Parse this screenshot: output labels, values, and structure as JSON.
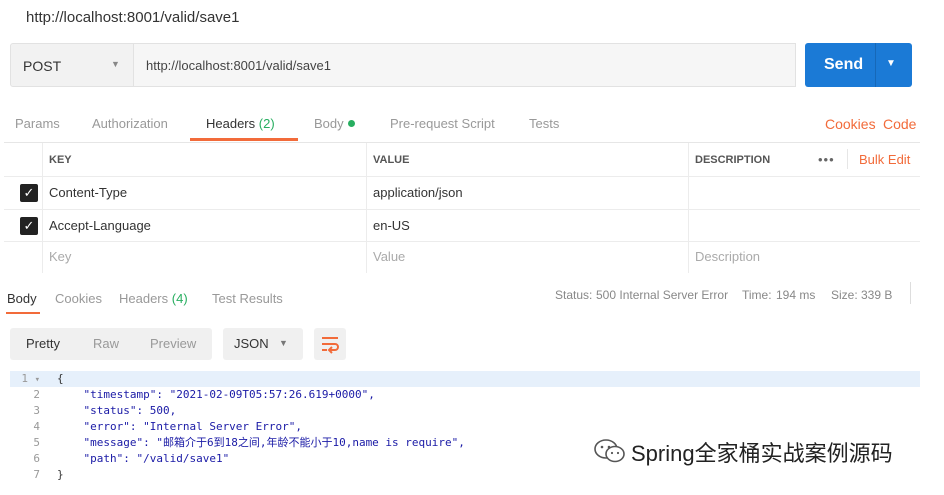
{
  "title": "http://localhost:8001/valid/save1",
  "request": {
    "method": "POST",
    "url": "http://localhost:8001/valid/save1",
    "send_label": "Send"
  },
  "req_tabs": {
    "params": "Params",
    "authorization": "Authorization",
    "headers": "Headers",
    "headers_count": "(2)",
    "body": "Body",
    "pre_request": "Pre-request Script",
    "tests": "Tests",
    "cookies": "Cookies",
    "code": "Code"
  },
  "headers_table": {
    "columns": [
      "KEY",
      "VALUE",
      "DESCRIPTION"
    ],
    "bulk_edit": "Bulk Edit",
    "more": "•••",
    "rows": [
      {
        "key": "Content-Type",
        "value": "application/json",
        "checked": true
      },
      {
        "key": "Accept-Language",
        "value": "en-US",
        "checked": true
      }
    ],
    "placeholder": {
      "key": "Key",
      "value": "Value",
      "description": "Description"
    }
  },
  "resp_tabs": {
    "body": "Body",
    "cookies": "Cookies",
    "headers": "Headers",
    "headers_count": "(4)",
    "test_results": "Test Results"
  },
  "status": {
    "status_label": "Status:",
    "status_value": "500 Internal Server Error",
    "time_label": "Time:",
    "time_value": "194 ms",
    "size_label": "Size:",
    "size_value": "339 B"
  },
  "view": {
    "pretty": "Pretty",
    "raw": "Raw",
    "preview": "Preview",
    "format": "JSON"
  },
  "code_lines": [
    {
      "n": "1",
      "text": "{"
    },
    {
      "n": "2",
      "text": "    \"timestamp\": \"2021-02-09T05:57:26.619+0000\","
    },
    {
      "n": "3",
      "text": "    \"status\": 500,"
    },
    {
      "n": "4",
      "text": "    \"error\": \"Internal Server Error\","
    },
    {
      "n": "5",
      "text": "    \"message\": \"邮箱介于6到18之间,年龄不能小于10,name is require\","
    },
    {
      "n": "6",
      "text": "    \"path\": \"/valid/save1\""
    },
    {
      "n": "7",
      "text": "}"
    }
  ],
  "watermark": "Spring全家桶实战案例源码",
  "colors": {
    "accent": "#f26b3a",
    "send": "#1b7ad6",
    "success": "#27ae60"
  }
}
